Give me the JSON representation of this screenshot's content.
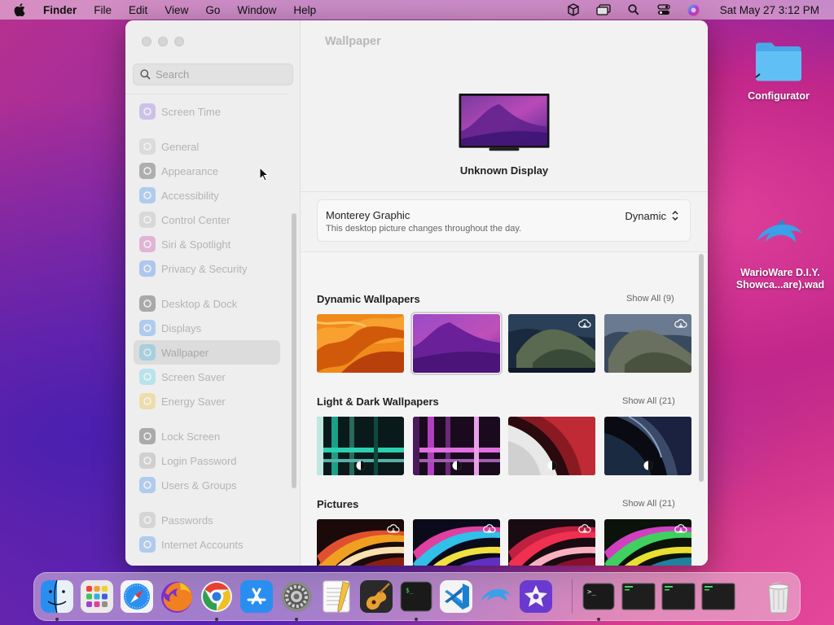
{
  "menubar": {
    "app_name": "Finder",
    "items": [
      "File",
      "Edit",
      "View",
      "Go",
      "Window",
      "Help"
    ],
    "clock": "Sat May 27  3:12 PM"
  },
  "desktop": {
    "configurator_label": "Configurator",
    "wad_label_line1": "WarioWare D.I.Y.",
    "wad_label_line2": "Showca...are).wad"
  },
  "sidebar": {
    "search_placeholder": "Search",
    "items": [
      {
        "label": "Screen Time",
        "color": "#8e6ee0"
      },
      {
        "label": "General",
        "color": "#b8b8b8"
      },
      {
        "label": "Appearance",
        "color": "#3a3a3a"
      },
      {
        "label": "Accessibility",
        "color": "#3d8bf0"
      },
      {
        "label": "Control Center",
        "color": "#b0b0b0"
      },
      {
        "label": "Siri & Spotlight",
        "color": "#c84aa8"
      },
      {
        "label": "Privacy & Security",
        "color": "#3d7ff0"
      },
      {
        "label": "Desktop & Dock",
        "color": "#2b2b2b"
      },
      {
        "label": "Displays",
        "color": "#3d8bf0"
      },
      {
        "label": "Wallpaper",
        "color": "#48b8e8"
      },
      {
        "label": "Screen Saver",
        "color": "#5ad0e8"
      },
      {
        "label": "Energy Saver",
        "color": "#f0c030"
      },
      {
        "label": "Lock Screen",
        "color": "#2e2e2e"
      },
      {
        "label": "Login Password",
        "color": "#9a9a9a"
      },
      {
        "label": "Users & Groups",
        "color": "#3d8bf0"
      },
      {
        "label": "Passwords",
        "color": "#a8a8a8"
      },
      {
        "label": "Internet Accounts",
        "color": "#3d8bf0"
      }
    ]
  },
  "main": {
    "title": "Wallpaper",
    "display_name": "Unknown Display",
    "current": {
      "name": "Monterey Graphic",
      "description": "This desktop picture changes throughout the day.",
      "mode": "Dynamic"
    },
    "sections": [
      {
        "title": "Dynamic Wallpapers",
        "show_all": "Show All (9)"
      },
      {
        "title": "Light & Dark Wallpapers",
        "show_all": "Show All (21)"
      },
      {
        "title": "Pictures",
        "show_all": "Show All (21)"
      }
    ]
  },
  "dock": {
    "apps": [
      "Finder",
      "Launchpad",
      "Safari",
      "Firefox",
      "Chrome",
      "App Store",
      "System Settings",
      "TextEdit",
      "GarageBand",
      "Terminal",
      "Visual Studio Code",
      "Dolphin",
      "iMovie",
      "Terminal",
      "Console",
      "Console",
      "Console",
      "Trash"
    ]
  }
}
